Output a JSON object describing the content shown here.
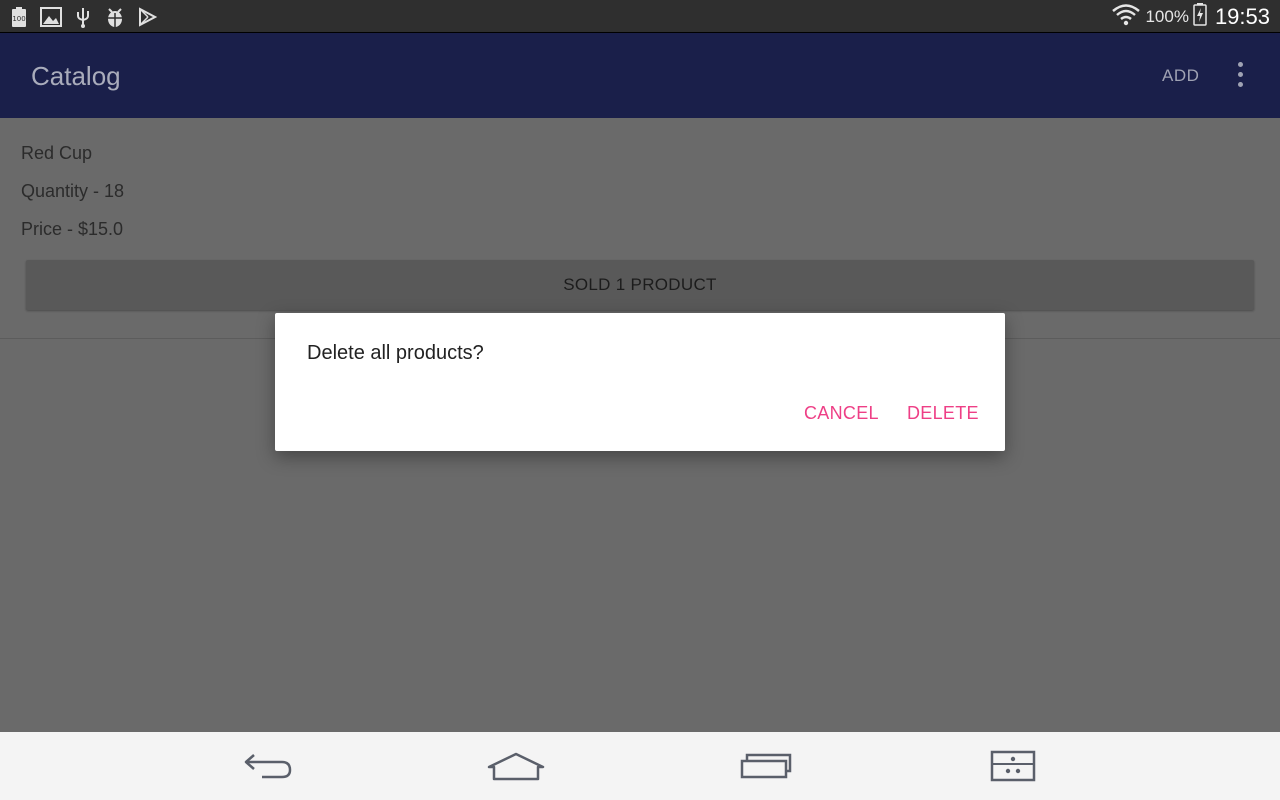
{
  "status_bar": {
    "icons": [
      "battery-100-icon",
      "gallery-icon",
      "usb-icon",
      "debug-bug-icon",
      "play-store-icon"
    ],
    "battery_percent": "100%",
    "time": "19:53"
  },
  "app_bar": {
    "title": "Catalog",
    "add_label": "ADD",
    "overflow_icon": "overflow-menu-icon",
    "background": "#1a1f4a"
  },
  "product": {
    "name": "Red Cup",
    "quantity": "Quantity - 18",
    "price": "Price - $15.0",
    "sold_button_label": "SOLD 1 PRODUCT"
  },
  "dialog": {
    "message": "Delete all products?",
    "cancel_label": "CANCEL",
    "delete_label": "DELETE",
    "accent_color": "#ee3f86"
  },
  "nav_bar": {
    "buttons": [
      "back-icon",
      "home-icon",
      "recent-apps-icon",
      "menu-icon"
    ]
  }
}
